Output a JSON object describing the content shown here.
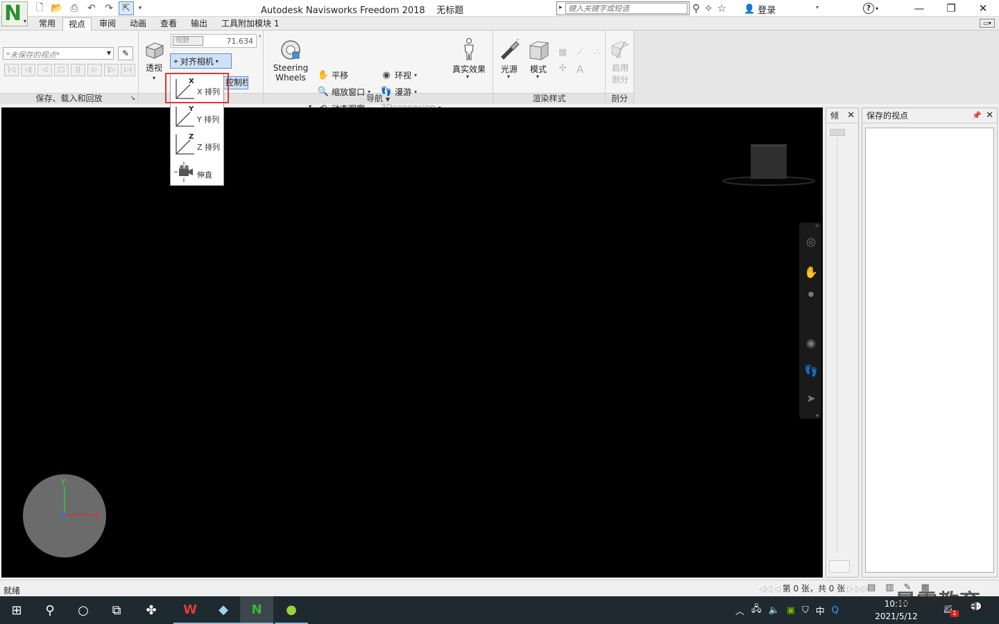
{
  "window": {
    "title": "Autodesk Navisworks Freedom 2018",
    "doc_title": "无标题",
    "search_placeholder": "键入关键字或短语",
    "login": "登录",
    "minimize": "—",
    "restore": "❐",
    "close": "✕"
  },
  "tabs": [
    {
      "label": "常用"
    },
    {
      "label": "视点",
      "active": true
    },
    {
      "label": "审阅"
    },
    {
      "label": "动画"
    },
    {
      "label": "查看"
    },
    {
      "label": "输出"
    },
    {
      "label": "工具附加模块 1"
    }
  ],
  "ribbon": {
    "save_panel": {
      "viewpoint_select": "*未保存的视点*",
      "title": "保存、载入和回放"
    },
    "camera_panel": {
      "perspective": "透视",
      "fov_label": "视野",
      "fov_value": "71.634",
      "fov_unit": "°",
      "align_camera": "对齐相机",
      "control_bar": "控制栏"
    },
    "nav_panel": {
      "steering_line1": "Steering",
      "steering_line2": "Wheels",
      "pan": "平移",
      "zoom_window": "缩放窗口",
      "orbit": "动态观察",
      "look_around": "环视",
      "walk": "漫游",
      "connexion": "3Dconnexion",
      "realism": "真实效果",
      "title": "导航"
    },
    "render_panel": {
      "lighting": "光源",
      "mode": "模式",
      "title": "渲染样式"
    },
    "section_panel": {
      "enable_line1": "启用",
      "enable_line2": "剖分",
      "title": "剖分"
    }
  },
  "align_menu": {
    "items": [
      {
        "label": "X 排列",
        "axis": "X"
      },
      {
        "label": "Y 排列",
        "axis": "Y"
      },
      {
        "label": "Z 排列",
        "axis": "Z"
      },
      {
        "label": "伸直"
      }
    ]
  },
  "viewport": {
    "compass_axes": {
      "y": "Y",
      "z": "Z",
      "x": "X"
    }
  },
  "side_panels": {
    "tilt_title": "倾",
    "saved_title": "保存的视点"
  },
  "status": {
    "ready": "就绪",
    "pager": "第 0 张，共 0 张"
  },
  "watermark": "晨需教育",
  "taskbar": {
    "ime": "中",
    "time": "10:10",
    "date": "2021/5/12",
    "badge": "1"
  },
  "colors": {
    "highlight_red": "#e03535",
    "selected_blue": "#cfe1f6",
    "brand_green": "#2f8f2f"
  }
}
